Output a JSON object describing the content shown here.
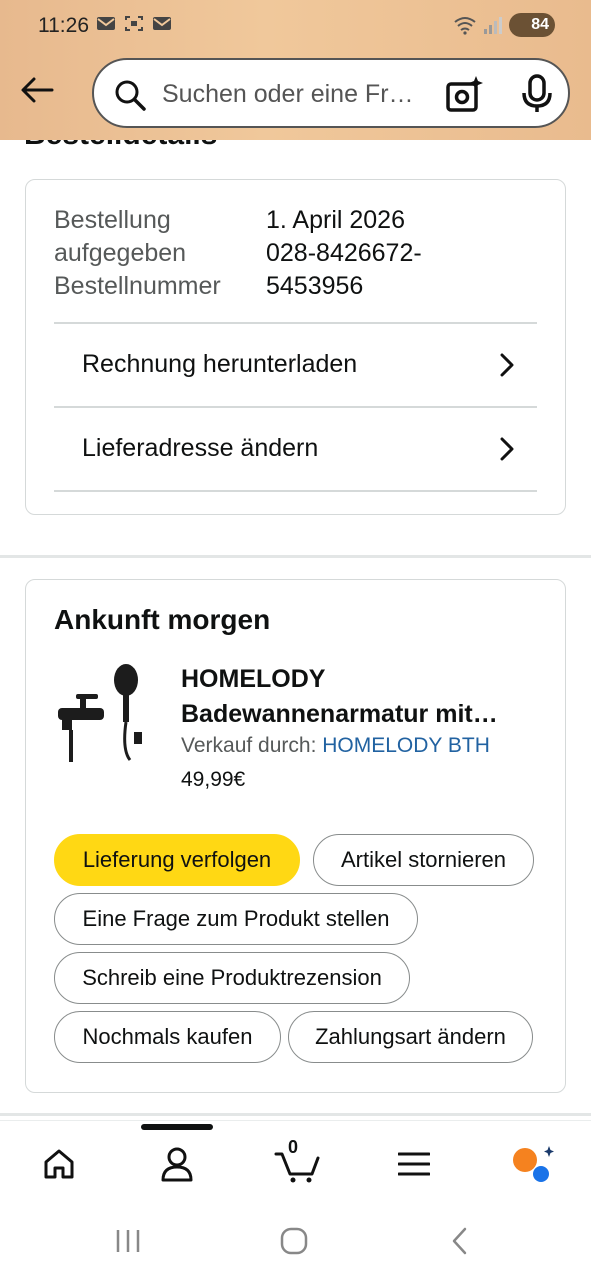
{
  "status_bar": {
    "time": "11:26",
    "battery": "84"
  },
  "search": {
    "placeholder": "Suchen oder eine Fr…"
  },
  "section_title": "Bestelldetails",
  "order": {
    "date_label": "Bestellung aufgegeben",
    "date_label_line1": "Bestellung",
    "date_label_line2": "aufgegeben",
    "date_value": "1. April 2026",
    "number_label": "Bestellnummer",
    "number_value_line1": "028-8426672-",
    "number_value_line2": "5453956",
    "links": [
      {
        "label": "Rechnung herunterladen"
      },
      {
        "label": "Lieferadresse ändern"
      }
    ]
  },
  "shipment": {
    "arrival": "Ankunft morgen",
    "product_title_line1": "HOMELODY",
    "product_title_line2": "Badewannenarmatur mit…",
    "seller_prefix": "Verkauf durch: ",
    "seller_name": "HOMELODY BTH",
    "price": "49,99€",
    "actions": [
      {
        "label": "Lieferung verfolgen"
      },
      {
        "label": "Artikel stornieren"
      },
      {
        "label": "Eine Frage zum Produkt stellen"
      },
      {
        "label": "Schreib eine Produktrezension"
      },
      {
        "label": "Nochmals kaufen"
      },
      {
        "label": "Zahlungsart ändern"
      }
    ]
  },
  "tabbar": {
    "cart_count": "0"
  },
  "colors": {
    "primary_button": "#ffd814",
    "link": "#2162a1",
    "header_bg": "#f0c89b"
  }
}
